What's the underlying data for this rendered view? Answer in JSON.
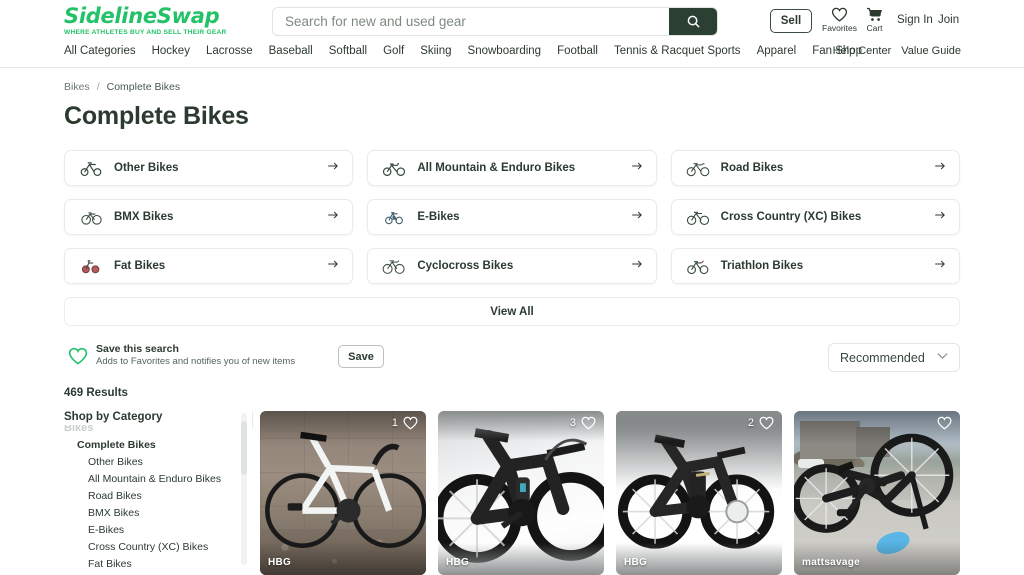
{
  "header": {
    "logo_main": "SidelineSwap",
    "logo_tagline": "WHERE ATHLETES BUY AND SELL THEIR GEAR",
    "brand_color": "#23c268",
    "search": {
      "placeholder": "Search for new and used gear",
      "value": "",
      "button_icon": "search-icon",
      "button_color": "#2c3f33"
    },
    "sell_label": "Sell",
    "favorites_label": "Favorites",
    "favorites_icon": "heart-icon",
    "cart_label": "Cart",
    "cart_icon": "cart-icon",
    "sign_in_label": "Sign In",
    "join_label": "Join",
    "nav_items": [
      "All Categories",
      "Hockey",
      "Lacrosse",
      "Baseball",
      "Softball",
      "Golf",
      "Skiing",
      "Snowboarding",
      "Football",
      "Tennis & Racquet Sports",
      "Apparel",
      "Fan Shop"
    ],
    "utility_links": [
      "Help Center",
      "Value Guide"
    ]
  },
  "breadcrumb": {
    "items": [
      "Bikes",
      "Complete Bikes"
    ],
    "separator": "/"
  },
  "page_title": "Complete Bikes",
  "category_cards": [
    {
      "label": "Other Bikes",
      "icon": "bike-icon",
      "arrow": "arrow-right-icon"
    },
    {
      "label": "All Mountain & Enduro Bikes",
      "icon": "bike-icon",
      "arrow": "arrow-right-icon"
    },
    {
      "label": "Road Bikes",
      "icon": "bike-icon",
      "arrow": "arrow-right-icon"
    },
    {
      "label": "BMX Bikes",
      "icon": "bike-icon",
      "arrow": "arrow-right-icon"
    },
    {
      "label": "E-Bikes",
      "icon": "bike-icon",
      "arrow": "arrow-right-icon"
    },
    {
      "label": "Cross Country (XC) Bikes",
      "icon": "bike-icon",
      "arrow": "arrow-right-icon"
    },
    {
      "label": "Fat Bikes",
      "icon": "bike-icon",
      "arrow": "arrow-right-icon"
    },
    {
      "label": "Cyclocross Bikes",
      "icon": "bike-icon",
      "arrow": "arrow-right-icon"
    },
    {
      "label": "Triathlon Bikes",
      "icon": "bike-icon",
      "arrow": "arrow-right-icon"
    }
  ],
  "view_all_label": "View All",
  "save_search": {
    "icon": "heart-outline-icon",
    "icon_color": "#23c268",
    "title": "Save this search",
    "subtitle": "Adds to Favorites and notifies you of new items",
    "button_label": "Save"
  },
  "sort": {
    "selected": "Recommended",
    "chevron": "chevron-down-icon"
  },
  "results_count": "469 Results",
  "sidebar": {
    "title": "Shop by Category",
    "ghost_text": "Bikes",
    "items": [
      {
        "label": "Complete Bikes",
        "level": 1
      },
      {
        "label": "Other Bikes",
        "level": 2
      },
      {
        "label": "All Mountain & Enduro Bikes",
        "level": 2
      },
      {
        "label": "Road Bikes",
        "level": 2
      },
      {
        "label": "BMX Bikes",
        "level": 2
      },
      {
        "label": "E-Bikes",
        "level": 2
      },
      {
        "label": "Cross Country (XC) Bikes",
        "level": 2
      },
      {
        "label": "Fat Bikes",
        "level": 2
      }
    ]
  },
  "products": [
    {
      "like_count": "1",
      "seller": "HBG",
      "scene": "white-road-bike-brick-wall",
      "heart": "heart-outline-icon"
    },
    {
      "like_count": "3",
      "seller": "HBG",
      "scene": "black-full-suspension-mtb-studio",
      "heart": "heart-outline-icon"
    },
    {
      "like_count": "2",
      "seller": "HBG",
      "scene": "black-e-mtb-studio",
      "heart": "heart-outline-icon"
    },
    {
      "like_count": "",
      "seller": "mattsavage",
      "scene": "bmx-bike-driveway",
      "heart": "heart-outline-icon"
    }
  ]
}
